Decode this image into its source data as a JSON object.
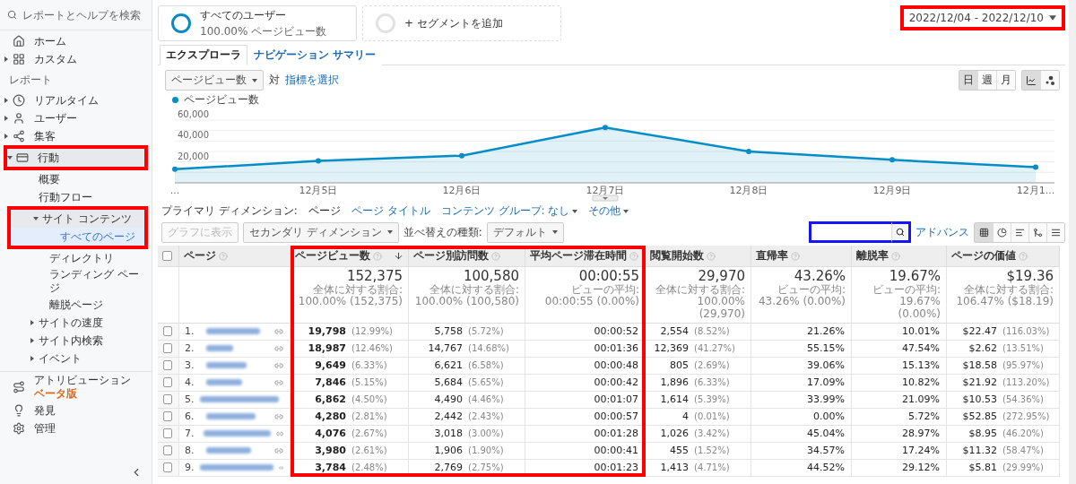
{
  "sidebar": {
    "search": {
      "placeholder": "レポートとヘルプを検索"
    },
    "top_items": [
      {
        "label": "ホーム",
        "selected": false
      },
      {
        "label": "カスタム",
        "selected": false,
        "expanded": false
      }
    ],
    "section_label": "レポート",
    "report_items": [
      {
        "label": "リアルタイム",
        "selected": false,
        "expanded": false
      },
      {
        "label": "ユーザー",
        "selected": false,
        "expanded": false
      },
      {
        "label": "集客",
        "selected": false,
        "expanded": false
      },
      {
        "label": "行動",
        "selected": true,
        "expanded": true,
        "highlighted": true,
        "children": [
          {
            "label": "概要",
            "selected": false
          },
          {
            "label": "行動フロー",
            "selected": false
          },
          {
            "label": "サイト コンテンツ",
            "selected": true,
            "expanded": true,
            "highlighted": true,
            "children": [
              {
                "label": "すべてのページ",
                "selected": true
              },
              {
                "label": "ディレクトリ",
                "selected": false
              },
              {
                "label": "ランディング ページ",
                "selected": false
              },
              {
                "label": "離脱ページ",
                "selected": false
              }
            ]
          },
          {
            "label": "サイトの速度",
            "selected": false,
            "expanded": false
          },
          {
            "label": "サイト内検索",
            "selected": false,
            "expanded": false
          },
          {
            "label": "イベント",
            "selected": false,
            "expanded": false
          }
        ]
      }
    ],
    "bottom_items": [
      {
        "label": "アトリビューション",
        "selected": false,
        "badge": "ベータ版"
      },
      {
        "label": "発見",
        "selected": false
      },
      {
        "label": "管理",
        "selected": false
      }
    ]
  },
  "segments": [
    {
      "kind": "active",
      "label": "すべてのユーザー",
      "detail": "100.00% ページビュー数"
    },
    {
      "kind": "add",
      "label": "+ セグメントを追加"
    }
  ],
  "date_range": {
    "value": "2022/12/04 - 2022/12/10",
    "highlighted": true
  },
  "tabs": [
    {
      "label": "エクスプローラ",
      "selected": true
    },
    {
      "label": "ナビゲーション サマリー",
      "selected": false
    }
  ],
  "chart_controls": {
    "metric": "ページビュー数",
    "versus": "対",
    "choose_metric": "指標を選択",
    "periods": [
      {
        "label": "日",
        "selected": true
      },
      {
        "label": "週",
        "selected": false
      },
      {
        "label": "月",
        "selected": false
      }
    ],
    "chart_types": [
      {
        "selected": true
      },
      {
        "selected": false
      }
    ]
  },
  "chart": {
    "chart_data": {
      "type": "area",
      "categories": [
        "...",
        "12月5日",
        "12月6日",
        "12月7日",
        "12月8日",
        "12月9日",
        "12月1..."
      ],
      "series": [
        {
          "name": "ページビュー数",
          "color": "#058dc7",
          "values": [
            13000,
            21000,
            26000,
            53000,
            30000,
            22000,
            15000
          ]
        }
      ],
      "ylim": [
        0,
        60000
      ],
      "yticks": [
        {
          "value": 20000,
          "label": "20,000"
        },
        {
          "value": 40000,
          "label": "40,000"
        },
        {
          "value": 60000,
          "label": "60,000"
        }
      ]
    }
  },
  "dimension_bar": {
    "label": "プライマリ ディメンション:",
    "options": [
      {
        "label": "ページ",
        "selected": true
      },
      {
        "label": "ページ タイトル",
        "selected": false
      },
      {
        "label": "コンテンツ グループ: なし",
        "selected": false,
        "dropdown": true
      },
      {
        "label": "その他",
        "selected": false,
        "dropdown": true
      }
    ]
  },
  "toolbar": {
    "plot_rows": {
      "label": "グラフに表示",
      "disabled": true
    },
    "secondary_dimension": "セカンダリ ディメンション",
    "sort_label": "並べ替えの種類:",
    "sort_type": "デフォルト",
    "search": {
      "highlighted": true
    },
    "advanced": "アドバンス",
    "views": [
      {
        "selected": true
      },
      {
        "selected": false
      },
      {
        "selected": false
      },
      {
        "selected": false
      },
      {
        "selected": false
      }
    ]
  },
  "table": {
    "select_all": {
      "checked": false
    },
    "page_column": {
      "label": "ページ"
    },
    "columns": [
      {
        "label": "ページビュー数",
        "highlighted": true,
        "sorted": true
      },
      {
        "label": "ページ別訪問数",
        "highlighted": true,
        "sorted": false
      },
      {
        "label": "平均ページ滞在時間",
        "highlighted": true,
        "sorted": false
      },
      {
        "label": "閲覧開始数",
        "highlighted": false,
        "sorted": false
      },
      {
        "label": "直帰率",
        "highlighted": false,
        "sorted": false
      },
      {
        "label": "離脱率",
        "highlighted": false,
        "sorted": false
      },
      {
        "label": "ページの価値",
        "highlighted": false,
        "sorted": false
      }
    ],
    "totals": [
      {
        "value": "152,375",
        "note": "全体に対する割合: 100.00% (152,375)"
      },
      {
        "value": "100,580",
        "note": "全体に対する割合: 100.00% (100,580)"
      },
      {
        "value": "00:00:55",
        "note": "ビューの平均: 00:00:55 (0.00%)"
      },
      {
        "value": "29,970",
        "note": "全体に対する割合: 100.00% (29,970)"
      },
      {
        "value": "43.26%",
        "note": "ビューの平均: 43.26% (0.00%)"
      },
      {
        "value": "19.67%",
        "note": "ビューの平均: 19.67% (0.00%)"
      },
      {
        "value": "$19.36",
        "note": "全体に対する割合: 106.47% ($18.19)"
      }
    ],
    "rows": [
      {
        "index": "1.",
        "checked": false,
        "cells": [
          {
            "value": "19,798",
            "share": "(12.99%)"
          },
          {
            "value": "5,758",
            "share": "(5.72%)"
          },
          {
            "value": "00:00:52"
          },
          {
            "value": "2,554",
            "share": "(8.52%)"
          },
          {
            "value": "21.26%"
          },
          {
            "value": "10.01%"
          },
          {
            "value": "$22.47",
            "share": "(116.03%)"
          }
        ]
      },
      {
        "index": "2.",
        "checked": false,
        "cells": [
          {
            "value": "18,987",
            "share": "(12.46%)"
          },
          {
            "value": "14,767",
            "share": "(14.68%)"
          },
          {
            "value": "00:01:36"
          },
          {
            "value": "12,369",
            "share": "(41.27%)"
          },
          {
            "value": "55.15%"
          },
          {
            "value": "47.54%"
          },
          {
            "value": "$2.62",
            "share": "(13.51%)"
          }
        ]
      },
      {
        "index": "3.",
        "checked": false,
        "cells": [
          {
            "value": "9,649",
            "share": "(6.33%)"
          },
          {
            "value": "6,621",
            "share": "(6.58%)"
          },
          {
            "value": "00:00:48"
          },
          {
            "value": "805",
            "share": "(2.69%)"
          },
          {
            "value": "39.06%"
          },
          {
            "value": "15.13%"
          },
          {
            "value": "$18.58",
            "share": "(95.97%)"
          }
        ]
      },
      {
        "index": "4.",
        "checked": false,
        "cells": [
          {
            "value": "7,846",
            "share": "(5.15%)"
          },
          {
            "value": "5,684",
            "share": "(5.65%)"
          },
          {
            "value": "00:00:42"
          },
          {
            "value": "1,896",
            "share": "(6.33%)"
          },
          {
            "value": "17.09%"
          },
          {
            "value": "10.82%"
          },
          {
            "value": "$21.92",
            "share": "(113.20%)"
          }
        ]
      },
      {
        "index": "5.",
        "checked": false,
        "cells": [
          {
            "value": "6,862",
            "share": "(4.50%)"
          },
          {
            "value": "4,490",
            "share": "(4.46%)"
          },
          {
            "value": "00:01:07"
          },
          {
            "value": "1,614",
            "share": "(5.39%)"
          },
          {
            "value": "33.99%"
          },
          {
            "value": "21.09%"
          },
          {
            "value": "$10.53",
            "share": "(54.36%)"
          }
        ]
      },
      {
        "index": "6.",
        "checked": false,
        "cells": [
          {
            "value": "4,280",
            "share": "(2.81%)"
          },
          {
            "value": "2,442",
            "share": "(2.43%)"
          },
          {
            "value": "00:00:57"
          },
          {
            "value": "4",
            "share": "(0.01%)"
          },
          {
            "value": "0.00%"
          },
          {
            "value": "5.72%"
          },
          {
            "value": "$52.85",
            "share": "(272.95%)"
          }
        ]
      },
      {
        "index": "7.",
        "checked": false,
        "cells": [
          {
            "value": "4,076",
            "share": "(2.67%)"
          },
          {
            "value": "3,018",
            "share": "(3.00%)"
          },
          {
            "value": "00:01:28"
          },
          {
            "value": "1,026",
            "share": "(3.42%)"
          },
          {
            "value": "45.04%"
          },
          {
            "value": "28.97%"
          },
          {
            "value": "$8.95",
            "share": "(46.20%)"
          }
        ]
      },
      {
        "index": "8.",
        "checked": false,
        "cells": [
          {
            "value": "3,980",
            "share": "(2.61%)"
          },
          {
            "value": "1,906",
            "share": "(1.90%)"
          },
          {
            "value": "00:00:41"
          },
          {
            "value": "455",
            "share": "(1.52%)"
          },
          {
            "value": "34.57%"
          },
          {
            "value": "17.24%"
          },
          {
            "value": "$11.32",
            "share": "(58.47%)"
          }
        ]
      },
      {
        "index": "9.",
        "checked": false,
        "cells": [
          {
            "value": "3,784",
            "share": "(2.48%)"
          },
          {
            "value": "2,769",
            "share": "(2.75%)"
          },
          {
            "value": "00:01:23"
          },
          {
            "value": "1,413",
            "share": "(4.71%)"
          },
          {
            "value": "44.52%"
          },
          {
            "value": "29.12%"
          },
          {
            "value": "$5.81",
            "share": "(29.99%)"
          }
        ]
      }
    ]
  }
}
